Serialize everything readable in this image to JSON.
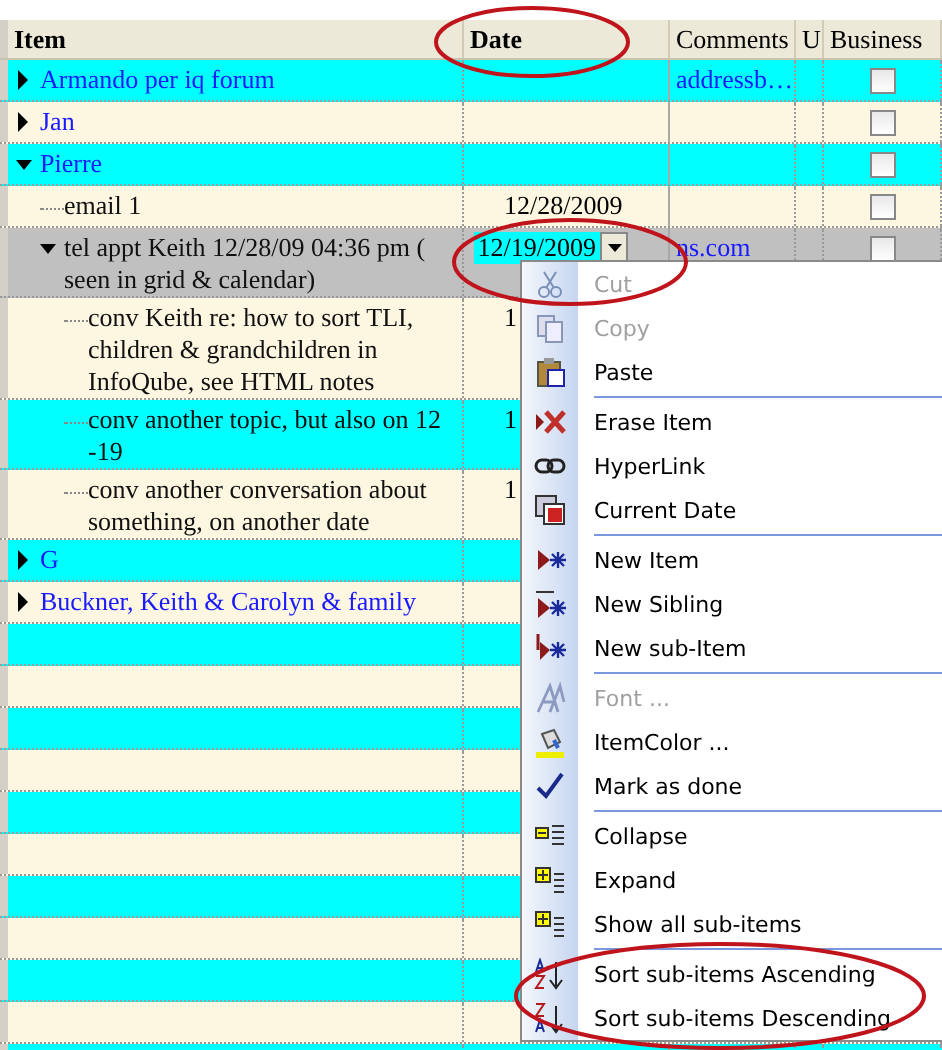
{
  "columns": [
    {
      "label": "Item"
    },
    {
      "label": "Date"
    },
    {
      "label": "Comments"
    },
    {
      "label": "U"
    },
    {
      "label": "Business"
    }
  ],
  "rows": [
    {
      "item": "Armando per iq forum",
      "expanded": false,
      "selected": false,
      "comments": "addressb…",
      "business": false
    },
    {
      "item": "Jan",
      "expanded": false,
      "selected": false,
      "business": false
    },
    {
      "item": "Pierre",
      "expanded": true,
      "selected": false,
      "business": false,
      "children": [
        {
          "item": "email 1",
          "selected": false,
          "date": "12/28/2009",
          "business": false
        },
        {
          "item": "tel appt Keith 12/28/09 04:36 pm ( seen in grid & calendar)",
          "expanded": true,
          "selected": true,
          "date": "12/19/2009",
          "comments": "ns.com",
          "business": false,
          "children": [
            {
              "item": "conv Keith re: how to sort TLI, children & grandchildren in InfoQube, see HTML notes",
              "selected": false,
              "date": "1"
            },
            {
              "item": "conv another topic, but also on 12 -19",
              "selected": false,
              "date": "1"
            },
            {
              "item": "conv another conversation about something, on another date",
              "selected": false,
              "date": "1"
            }
          ]
        }
      ]
    },
    {
      "item": "G",
      "expanded": false,
      "selected": false
    },
    {
      "item": "Buckner, Keith & Carolyn & family",
      "expanded": false,
      "selected": false
    }
  ],
  "context_menu": {
    "groups": [
      [
        {
          "label": "Cut",
          "disabled": true
        },
        {
          "label": "Copy",
          "disabled": true
        },
        {
          "label": "Paste",
          "disabled": false
        }
      ],
      [
        {
          "label": "Erase Item",
          "disabled": false
        },
        {
          "label": "HyperLink",
          "disabled": false
        },
        {
          "label": "Current Date",
          "disabled": false
        }
      ],
      [
        {
          "label": "New Item",
          "disabled": false
        },
        {
          "label": "New Sibling",
          "disabled": false
        },
        {
          "label": "New sub-Item",
          "disabled": false
        }
      ],
      [
        {
          "label": "Font ...",
          "disabled": true
        },
        {
          "label": "ItemColor ...",
          "disabled": false
        },
        {
          "label": "Mark as done",
          "disabled": false
        }
      ],
      [
        {
          "label": "Collapse",
          "disabled": false
        },
        {
          "label": "Expand",
          "disabled": false
        },
        {
          "label": "Show all sub-items",
          "disabled": false
        }
      ],
      [
        {
          "label": "Sort sub-items Ascending",
          "disabled": false
        },
        {
          "label": "Sort sub-items Descending",
          "disabled": false
        }
      ]
    ]
  }
}
